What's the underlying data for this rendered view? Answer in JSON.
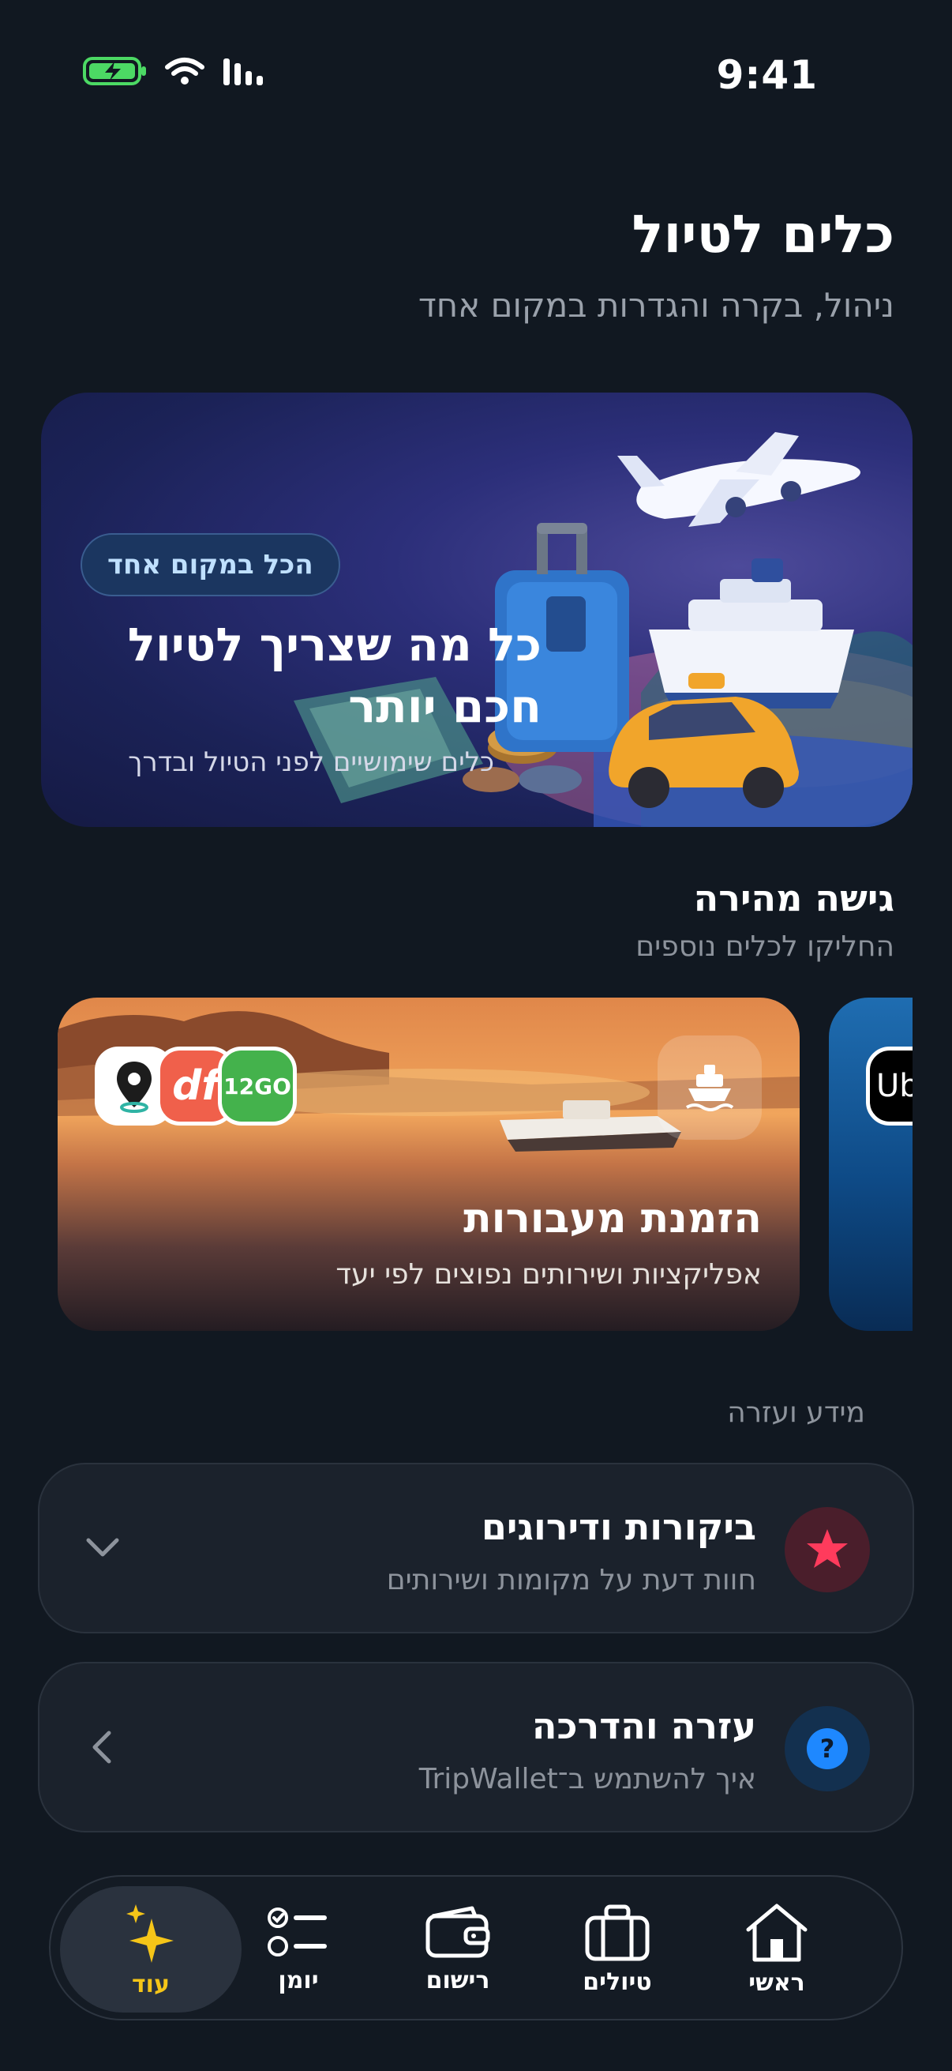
{
  "status_bar": {
    "time": "9:41"
  },
  "header": {
    "title": "כלים לטיול",
    "subtitle": "ניהול, בקרה והגדרות במקום אחד"
  },
  "hero": {
    "badge": "הכל במקום אחד",
    "title": "כל מה שצריך לטיול חכם יותר",
    "description": "כלים שימושיים לפני הטיול ובדרך"
  },
  "quick_access": {
    "title": "גישה מהירה",
    "subtitle": "החליקו לכלים נוספים",
    "cards": [
      {
        "title": "הזמנת מעבורות",
        "description": "אפליקציות ושירותים נפוצים לפי יעד",
        "apps": [
          "df",
          "12GO"
        ]
      },
      {
        "apps": [
          "Ube"
        ]
      }
    ]
  },
  "info": {
    "label": "מידע ועזרה",
    "items": [
      {
        "title": "ביקורות ודירוגים",
        "subtitle": "חוות דעת על מקומות ושירותים"
      },
      {
        "title": "עזרה והדרכה",
        "subtitle": "איך להשתמש ב־TripWallet"
      }
    ]
  },
  "nav": {
    "items": [
      {
        "label": "ראשי"
      },
      {
        "label": "טיולים"
      },
      {
        "label": "רישום"
      },
      {
        "label": "יומן"
      },
      {
        "label": "עוד"
      }
    ]
  },
  "colors": {
    "background": "#111821",
    "accent_active": "#f5c518",
    "star_red": "#ff3b5c",
    "help_blue": "#1e88ff"
  }
}
